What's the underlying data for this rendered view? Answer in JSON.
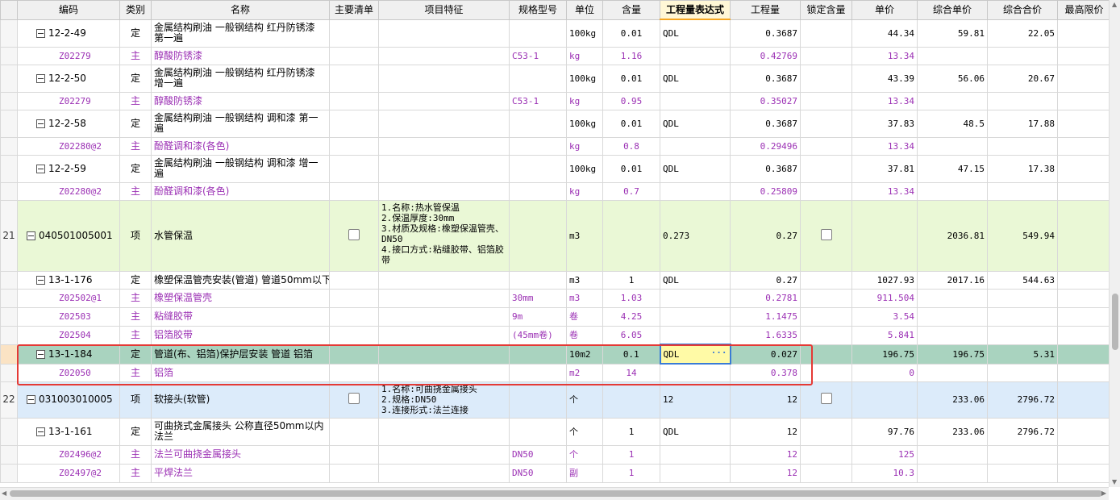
{
  "headers": [
    "",
    "编码",
    "类别",
    "名称",
    "主要清单",
    "项目特征",
    "规格型号",
    "单位",
    "含量",
    "工程量表达式",
    "工程量",
    "锁定含量",
    "单价",
    "综合单价",
    "综合合价",
    "最高限价"
  ],
  "rows": [
    {
      "idx": "",
      "code": "12-2-49",
      "type": "定",
      "name": "金属结构刷油 一般钢结构 红丹防锈漆 第一遍",
      "feature": "",
      "spec": "",
      "unit": "100kg",
      "content": "0.01",
      "expr": "QDL",
      "qty": "0.3687",
      "price": "44.34",
      "comp_price": "59.81",
      "comp_total": "22.05"
    },
    {
      "idx": "",
      "code": "Z02279",
      "type": "主",
      "name": "醇酸防锈漆",
      "feature": "",
      "spec": "C53-1",
      "unit": "kg",
      "content": "1.16",
      "expr": "",
      "qty": "0.42769",
      "price": "13.34",
      "comp_price": "",
      "comp_total": ""
    },
    {
      "idx": "",
      "code": "12-2-50",
      "type": "定",
      "name": "金属结构刷油 一般钢结构 红丹防锈漆 增一遍",
      "feature": "",
      "spec": "",
      "unit": "100kg",
      "content": "0.01",
      "expr": "QDL",
      "qty": "0.3687",
      "price": "43.39",
      "comp_price": "56.06",
      "comp_total": "20.67"
    },
    {
      "idx": "",
      "code": "Z02279",
      "type": "主",
      "name": "醇酸防锈漆",
      "feature": "",
      "spec": "C53-1",
      "unit": "kg",
      "content": "0.95",
      "expr": "",
      "qty": "0.35027",
      "price": "13.34",
      "comp_price": "",
      "comp_total": ""
    },
    {
      "idx": "",
      "code": "12-2-58",
      "type": "定",
      "name": "金属结构刷油 一般钢结构 调和漆 第一遍",
      "feature": "",
      "spec": "",
      "unit": "100kg",
      "content": "0.01",
      "expr": "QDL",
      "qty": "0.3687",
      "price": "37.83",
      "comp_price": "48.5",
      "comp_total": "17.88"
    },
    {
      "idx": "",
      "code": "Z02280@2",
      "type": "主",
      "name": "酚醛调和漆(各色)",
      "feature": "",
      "spec": "",
      "unit": "kg",
      "content": "0.8",
      "expr": "",
      "qty": "0.29496",
      "price": "13.34",
      "comp_price": "",
      "comp_total": ""
    },
    {
      "idx": "",
      "code": "12-2-59",
      "type": "定",
      "name": "金属结构刷油 一般钢结构 调和漆 增一遍",
      "feature": "",
      "spec": "",
      "unit": "100kg",
      "content": "0.01",
      "expr": "QDL",
      "qty": "0.3687",
      "price": "37.81",
      "comp_price": "47.15",
      "comp_total": "17.38"
    },
    {
      "idx": "",
      "code": "Z02280@2",
      "type": "主",
      "name": "酚醛调和漆(各色)",
      "feature": "",
      "spec": "",
      "unit": "kg",
      "content": "0.7",
      "expr": "",
      "qty": "0.25809",
      "price": "13.34",
      "comp_price": "",
      "comp_total": ""
    },
    {
      "idx": "21",
      "code": "040501005001",
      "type": "项",
      "name": "水管保温",
      "feature": "1.名称:热水管保温\n2.保温厚度:30mm\n3.材质及规格:橡塑保温管壳、DN50\n4.接口方式:粘缝胶带、铝箔胶带",
      "spec": "",
      "unit": "m3",
      "content": "",
      "expr": "0.273",
      "qty": "0.27",
      "price": "",
      "comp_price": "2036.81",
      "comp_total": "549.94"
    },
    {
      "idx": "",
      "code": "13-1-176",
      "type": "定",
      "name": "橡塑保温管壳安装(管道) 管道50mm以下",
      "feature": "",
      "spec": "",
      "unit": "m3",
      "content": "1",
      "expr": "QDL",
      "qty": "0.27",
      "price": "1027.93",
      "comp_price": "2017.16",
      "comp_total": "544.63"
    },
    {
      "idx": "",
      "code": "Z02502@1",
      "type": "主",
      "name": "橡塑保温管壳",
      "feature": "",
      "spec": "30mm",
      "unit": "m3",
      "content": "1.03",
      "expr": "",
      "qty": "0.2781",
      "price": "911.504",
      "comp_price": "",
      "comp_total": ""
    },
    {
      "idx": "",
      "code": "Z02503",
      "type": "主",
      "name": "粘缝胶带",
      "feature": "",
      "spec": "9m",
      "unit": "卷",
      "content": "4.25",
      "expr": "",
      "qty": "1.1475",
      "price": "3.54",
      "comp_price": "",
      "comp_total": ""
    },
    {
      "idx": "",
      "code": "Z02504",
      "type": "主",
      "name": "铝箔胶带",
      "feature": "",
      "spec": "(45mm卷)",
      "unit": "卷",
      "content": "6.05",
      "expr": "",
      "qty": "1.6335",
      "price": "5.841",
      "comp_price": "",
      "comp_total": ""
    },
    {
      "idx": "",
      "code": "13-1-184",
      "type": "定",
      "name": "管道(布、铝箔)保护层安装 管道 铝箔",
      "feature": "",
      "spec": "",
      "unit": "10m2",
      "content": "0.1",
      "expr": "QDL",
      "qty": "0.027",
      "price": "196.75",
      "comp_price": "196.75",
      "comp_total": "5.31"
    },
    {
      "idx": "",
      "code": "Z02050",
      "type": "主",
      "name": "铝箔",
      "feature": "",
      "spec": "",
      "unit": "m2",
      "content": "14",
      "expr": "",
      "qty": "0.378",
      "price": "0",
      "comp_price": "",
      "comp_total": ""
    },
    {
      "idx": "22",
      "code": "031003010005",
      "type": "项",
      "name": "软接头(软管)",
      "feature": "1.名称:可曲挠金属接头\n2.规格:DN50\n3.连接形式:法兰连接",
      "spec": "",
      "unit": "个",
      "content": "",
      "expr": "12",
      "qty": "12",
      "price": "",
      "comp_price": "233.06",
      "comp_total": "2796.72"
    },
    {
      "idx": "",
      "code": "13-1-161",
      "type": "定",
      "name": "可曲挠式金属接头 公称直径50mm以内 法兰",
      "feature": "",
      "spec": "",
      "unit": "个",
      "content": "1",
      "expr": "QDL",
      "qty": "12",
      "price": "97.76",
      "comp_price": "233.06",
      "comp_total": "2796.72"
    },
    {
      "idx": "",
      "code": "Z02496@2",
      "type": "主",
      "name": "法兰可曲挠金属接头",
      "feature": "",
      "spec": "DN50",
      "unit": "个",
      "content": "1",
      "expr": "",
      "qty": "12",
      "price": "125",
      "comp_price": "",
      "comp_total": ""
    },
    {
      "idx": "",
      "code": "Z02497@2",
      "type": "主",
      "name": "平焊法兰",
      "feature": "",
      "spec": "DN50",
      "unit": "副",
      "content": "1",
      "expr": "",
      "qty": "12",
      "price": "10.3",
      "comp_price": "",
      "comp_total": ""
    }
  ],
  "colors": {
    "selected_row": "#a9d3bf",
    "bill_row_green": "#eaf8d6",
    "bill_row_blue": "#dcebfa",
    "material_text": "#9b30b4",
    "highlight_box": "#e53935",
    "edit_cell": "#fffaa6"
  },
  "icons": {
    "collapse": "collapse-minus-icon",
    "ellipsis": "ellipsis-icon"
  },
  "edit_ellipsis": "···"
}
